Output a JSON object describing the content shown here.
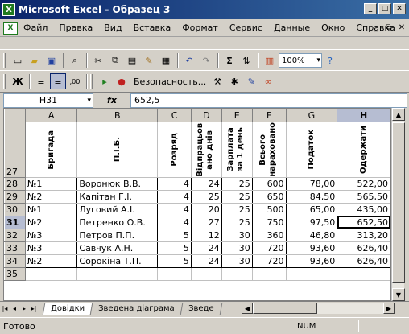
{
  "window": {
    "title": "Microsoft Excel - Образец 3",
    "app_icon": "excel-icon"
  },
  "menu": [
    "Файл",
    "Правка",
    "Вид",
    "Вставка",
    "Формат",
    "Сервис",
    "Данные",
    "Окно",
    "Справка"
  ],
  "toolbar": {
    "zoom": "100%",
    "security_label": "Безопасность...",
    "bold_label": "Ж"
  },
  "formula": {
    "name_box": "H31",
    "fx": "fx",
    "value": "652,5"
  },
  "columns": [
    "A",
    "B",
    "C",
    "D",
    "E",
    "F",
    "G",
    "H"
  ],
  "header_row": {
    "row_number": "27",
    "cells": [
      "Бригада",
      "П.І.Б.",
      "Розряд",
      "Відпрацьов ано днів",
      "Зарплата за 1 день",
      "Всього нараховано",
      "Податок",
      "Одержати"
    ]
  },
  "rows": [
    {
      "n": "28",
      "cells": [
        "№1",
        "Воронюк В.В.",
        "4",
        "24",
        "25",
        "600",
        "78,00",
        "522,00"
      ]
    },
    {
      "n": "29",
      "cells": [
        "№2",
        "Капітан Г.І.",
        "4",
        "25",
        "25",
        "650",
        "84,50",
        "565,50"
      ]
    },
    {
      "n": "30",
      "cells": [
        "№1",
        "Луговий А.І.",
        "4",
        "20",
        "25",
        "500",
        "65,00",
        "435,00"
      ]
    },
    {
      "n": "31",
      "cells": [
        "№2",
        "Петренко О.В.",
        "4",
        "27",
        "25",
        "750",
        "97,50",
        "652,50"
      ]
    },
    {
      "n": "32",
      "cells": [
        "№3",
        "Петров П.П.",
        "5",
        "12",
        "30",
        "360",
        "46,80",
        "313,20"
      ]
    },
    {
      "n": "33",
      "cells": [
        "№3",
        "Савчук А.Н.",
        "5",
        "24",
        "30",
        "720",
        "93,60",
        "626,40"
      ]
    },
    {
      "n": "34",
      "cells": [
        "№2",
        "Сорокіна Т.П.",
        "5",
        "24",
        "30",
        "720",
        "93,60",
        "626,40"
      ]
    },
    {
      "n": "35",
      "cells": [
        "",
        "",
        "",
        "",
        "",
        "",
        "",
        ""
      ]
    }
  ],
  "active": {
    "row": "31",
    "col": "H"
  },
  "sheets": [
    "Довідки",
    "Зведена діаграма",
    "Зведе"
  ],
  "status": {
    "ready": "Готово",
    "num": "NUM"
  }
}
